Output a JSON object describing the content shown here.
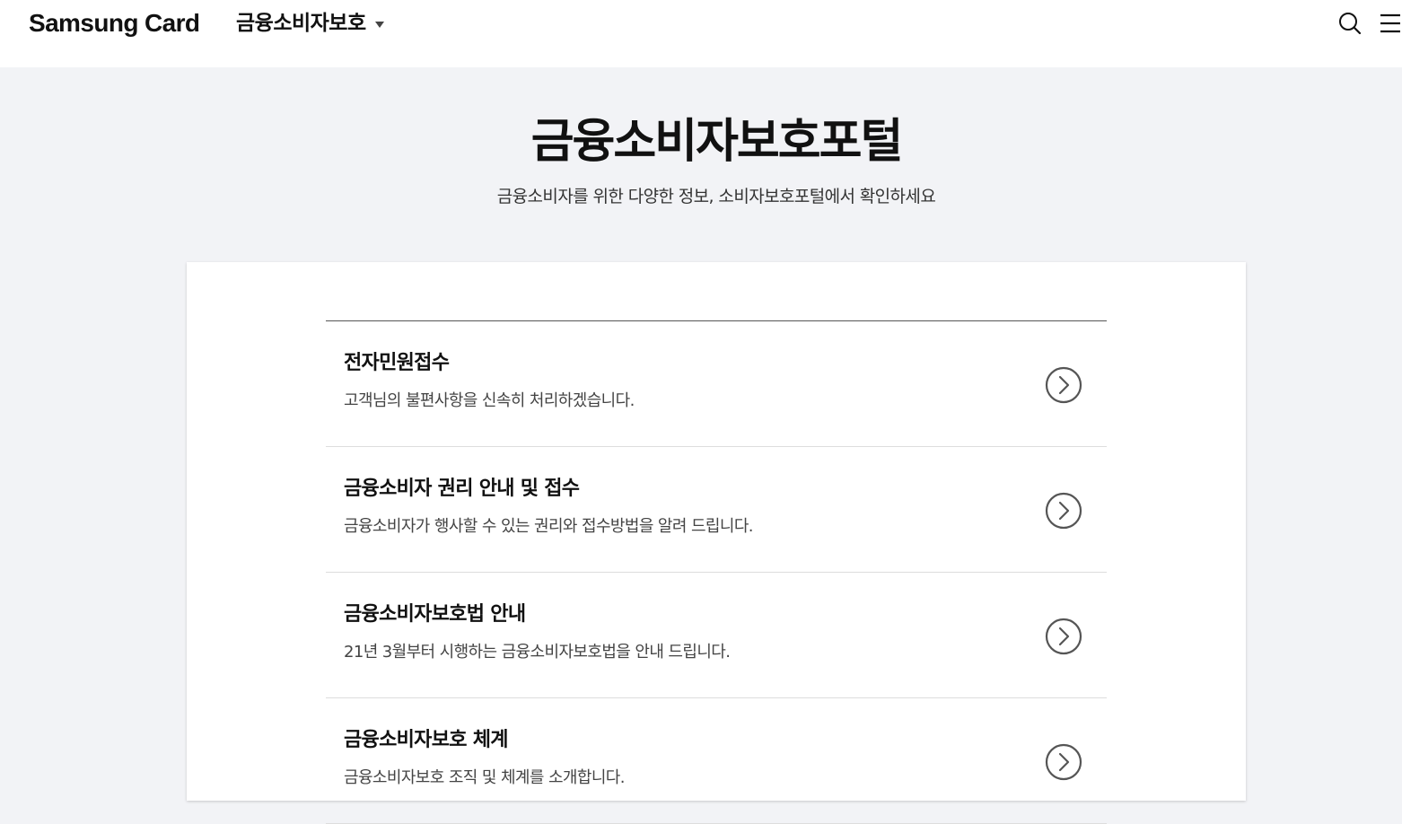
{
  "header": {
    "brand": "Samsung Card",
    "section_label": "금융소비자보호",
    "icons": {
      "caret": "chevron-down-icon",
      "search": "search-icon",
      "menu": "hamburger-menu-icon"
    }
  },
  "hero": {
    "title": "금융소비자보호포털",
    "subtitle": "금융소비자를 위한 다양한 정보, 소비자보호포털에서 확인하세요"
  },
  "items": [
    {
      "title": "전자민원접수",
      "desc": "고객님의 불편사항을 신속히 처리하겠습니다."
    },
    {
      "title": "금융소비자 권리 안내 및 접수",
      "desc": "금융소비자가 행사할 수 있는 권리와 접수방법을 알려 드립니다."
    },
    {
      "title": "금융소비자보호법 안내",
      "desc": "21년 3월부터 시행하는 금융소비자보호법을 안내 드립니다."
    },
    {
      "title": "금융소비자보호 체계",
      "desc": "금융소비자보호 조직 및 체계를 소개합니다."
    }
  ],
  "colors": {
    "page_background": "#f2f3f6",
    "card_background": "#ffffff",
    "text_primary": "#111111",
    "text_secondary": "#444444",
    "divider": "#dddddd",
    "list_top_border": "#555555",
    "arrow_icon": "#555555"
  }
}
